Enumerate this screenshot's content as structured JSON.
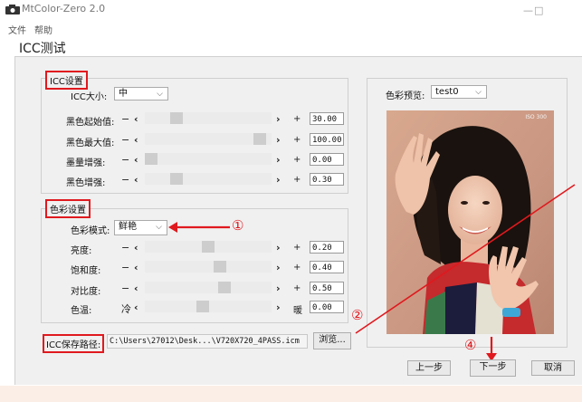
{
  "window": {
    "title": "MtColor-Zero 2.0",
    "minimize": "—",
    "maximize": "□"
  },
  "menu": {
    "file": "文件",
    "help": "帮助"
  },
  "page_title": "ICC测试",
  "icc_settings": {
    "label": "ICC设置",
    "size_label": "ICC大小:",
    "size_value": "中",
    "rows": [
      {
        "label": "黑色起始值:",
        "minus": "−",
        "plus": "+",
        "value": "30.00",
        "position": 0.22
      },
      {
        "label": "黑色最大值:",
        "minus": "−",
        "plus": "+",
        "value": "100.00",
        "position": 0.95
      },
      {
        "label": "墨量增强:",
        "minus": "−",
        "plus": "+",
        "value": "0.00",
        "position": 0.0
      },
      {
        "label": "黑色增强:",
        "minus": "−",
        "plus": "+",
        "value": "0.30",
        "position": 0.22
      }
    ]
  },
  "color_settings": {
    "label": "色彩设置",
    "mode_label": "色彩模式:",
    "mode_value": "鲜艳",
    "rows": [
      {
        "label": "亮度:",
        "minus": "−",
        "plus": "+",
        "value": "0.20",
        "position": 0.5
      },
      {
        "label": "饱和度:",
        "minus": "−",
        "plus": "+",
        "value": "0.40",
        "position": 0.6
      },
      {
        "label": "对比度:",
        "minus": "−",
        "plus": "+",
        "value": "0.50",
        "position": 0.64
      },
      {
        "label": "色温:",
        "minus": "冷",
        "plus": "暖",
        "value": "0.00",
        "position": 0.45
      }
    ]
  },
  "icc_path": {
    "label": "ICC保存路径:",
    "value": "C:\\Users\\27012\\Desk...\\V720X720_4PASS.icm",
    "browse": "浏览..."
  },
  "preview": {
    "label": "色彩预览:",
    "selected": "test0",
    "watermark": "ISO 300"
  },
  "buttons": {
    "prev": "上一步",
    "next": "下一步",
    "cancel": "取消"
  },
  "annotations": {
    "one": "①",
    "two": "②",
    "four": "④"
  },
  "colors": {
    "annotation_red": "#e0191e",
    "dialog_bg": "#f0f0f0",
    "footer_bg": "#fbeee6"
  },
  "icons": {
    "app": "camera-icon",
    "dropdown": "chevron-down-icon",
    "left": "chevron-left-icon",
    "right": "chevron-right-icon"
  }
}
